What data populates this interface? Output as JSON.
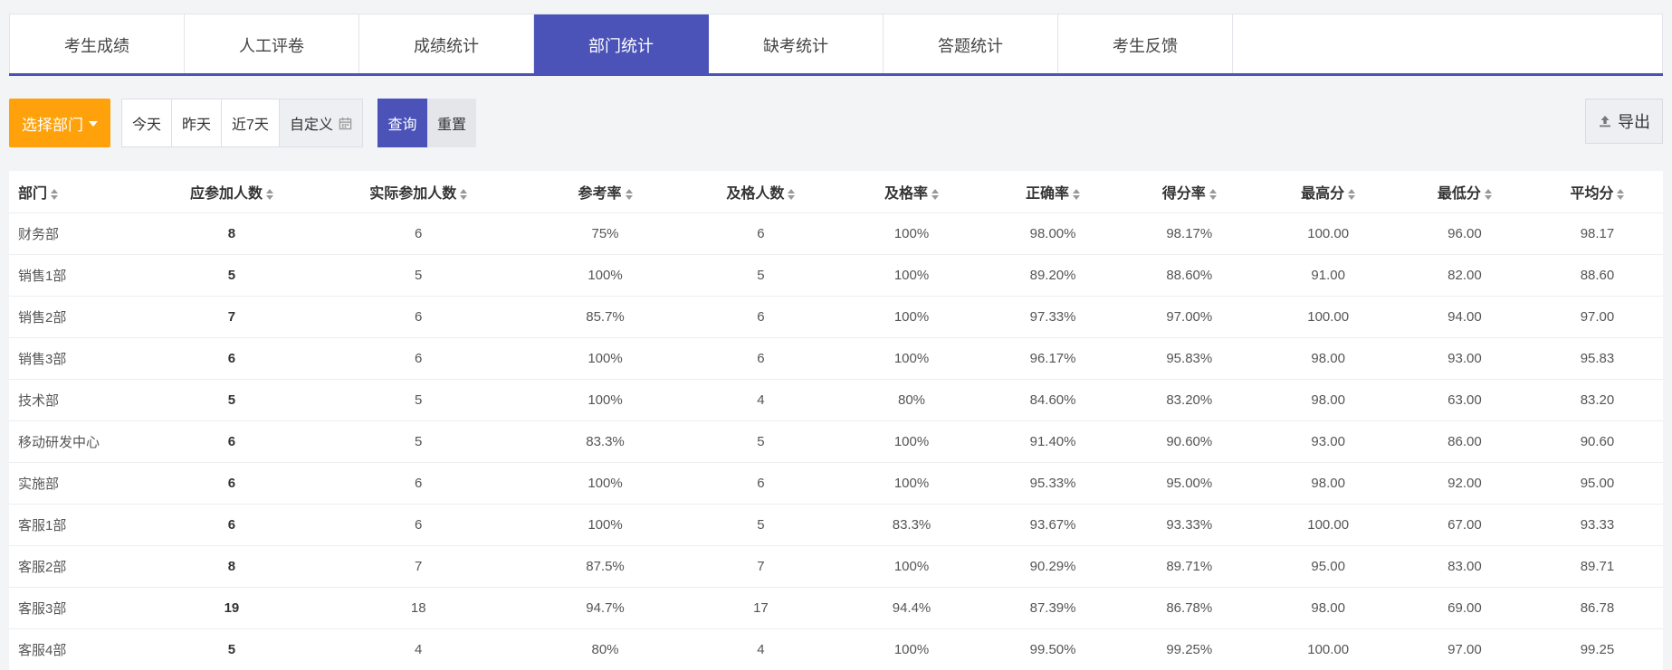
{
  "tabs": [
    {
      "label": "考生成绩"
    },
    {
      "label": "人工评卷"
    },
    {
      "label": "成绩统计"
    },
    {
      "label": "部门统计",
      "active": true
    },
    {
      "label": "缺考统计"
    },
    {
      "label": "答题统计"
    },
    {
      "label": "考生反馈"
    }
  ],
  "toolbar": {
    "dept_button": "选择部门",
    "date_today": "今天",
    "date_yesterday": "昨天",
    "date_7days": "近7天",
    "date_custom": "自定义",
    "query": "查询",
    "reset": "重置",
    "export": "导出"
  },
  "table": {
    "headers": [
      "部门",
      "应参加人数",
      "实际参加人数",
      "参考率",
      "及格人数",
      "及格率",
      "正确率",
      "得分率",
      "最高分",
      "最低分",
      "平均分"
    ],
    "rows": [
      [
        "财务部",
        "8",
        "6",
        "75%",
        "6",
        "100%",
        "98.00%",
        "98.17%",
        "100.00",
        "96.00",
        "98.17"
      ],
      [
        "销售1部",
        "5",
        "5",
        "100%",
        "5",
        "100%",
        "89.20%",
        "88.60%",
        "91.00",
        "82.00",
        "88.60"
      ],
      [
        "销售2部",
        "7",
        "6",
        "85.7%",
        "6",
        "100%",
        "97.33%",
        "97.00%",
        "100.00",
        "94.00",
        "97.00"
      ],
      [
        "销售3部",
        "6",
        "6",
        "100%",
        "6",
        "100%",
        "96.17%",
        "95.83%",
        "98.00",
        "93.00",
        "95.83"
      ],
      [
        "技术部",
        "5",
        "5",
        "100%",
        "4",
        "80%",
        "84.60%",
        "83.20%",
        "98.00",
        "63.00",
        "83.20"
      ],
      [
        "移动研发中心",
        "6",
        "5",
        "83.3%",
        "5",
        "100%",
        "91.40%",
        "90.60%",
        "93.00",
        "86.00",
        "90.60"
      ],
      [
        "实施部",
        "6",
        "6",
        "100%",
        "6",
        "100%",
        "95.33%",
        "95.00%",
        "98.00",
        "92.00",
        "95.00"
      ],
      [
        "客服1部",
        "6",
        "6",
        "100%",
        "5",
        "83.3%",
        "93.67%",
        "93.33%",
        "100.00",
        "67.00",
        "93.33"
      ],
      [
        "客服2部",
        "8",
        "7",
        "87.5%",
        "7",
        "100%",
        "90.29%",
        "89.71%",
        "95.00",
        "83.00",
        "89.71"
      ],
      [
        "客服3部",
        "19",
        "18",
        "94.7%",
        "17",
        "94.4%",
        "87.39%",
        "86.78%",
        "98.00",
        "69.00",
        "86.78"
      ],
      [
        "客服4部",
        "5",
        "4",
        "80%",
        "4",
        "100%",
        "99.50%",
        "99.25%",
        "100.00",
        "97.00",
        "99.25"
      ]
    ]
  },
  "colors": {
    "primary": "#4b53b8",
    "accent_orange": "#ffa10a",
    "background": "#f3f4f6"
  }
}
